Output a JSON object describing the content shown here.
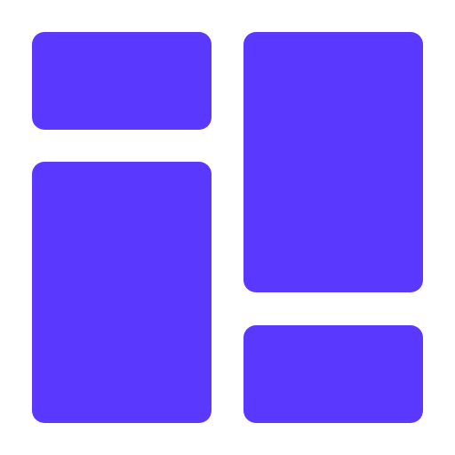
{
  "icon": {
    "name": "dashboard-layout-icon",
    "color": "#5b38fd",
    "background": "#ffffff"
  }
}
